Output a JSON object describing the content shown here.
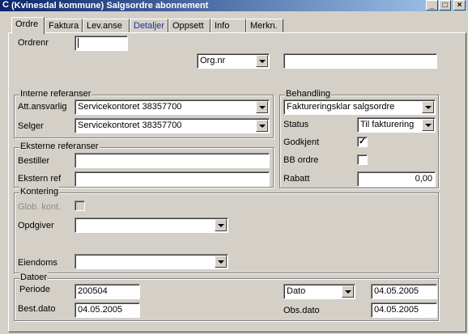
{
  "window": {
    "title": "(Kvinesdal kommune) Salgsordre abonnement",
    "title_icon_glyph": "С",
    "min_glyph": "_",
    "max_glyph": "□",
    "close_glyph": "×"
  },
  "tabs": [
    {
      "label": "Ordre"
    },
    {
      "label": "Faktura"
    },
    {
      "label": "Lev.anse"
    },
    {
      "label": "Detaljer"
    },
    {
      "label": "Oppsett"
    },
    {
      "label": "Info"
    },
    {
      "label": "Merkn."
    }
  ],
  "top": {
    "ordrenr_label": "Ordrenr",
    "ordrenr_value": "",
    "org_select_value": "Org.nr",
    "org_value": ""
  },
  "interne": {
    "title": "Interne referanser",
    "att_label": "Att.ansvarlig",
    "att_value": "Servicekontoret 38357700",
    "selger_label": "Selger",
    "selger_value": "Servicekontoret 38357700"
  },
  "eksterne": {
    "title": "Eksterne referanser",
    "bestiller_label": "Bestiller",
    "bestiller_value": "",
    "eksternref_label": "Ekstern ref",
    "eksternref_value": ""
  },
  "behandling": {
    "title": "Behandling",
    "type_value": "Faktureringsklar salgsordre",
    "status_label": "Status",
    "status_value": "Til fakturering",
    "godkjent_label": "Godkjent",
    "godkjent_mark": "✓",
    "bb_label": "BB ordre",
    "rabatt_label": "Rabatt",
    "rabatt_value": "0,00"
  },
  "kontering": {
    "title": "Kontering",
    "glob_label": "Glob. kont.",
    "opdgiver_label": "Opdgiver",
    "opdgiver_value": "",
    "eiendoms_label": "Eiendoms",
    "eiendoms_value": ""
  },
  "datoer": {
    "title": "Datoer",
    "periode_label": "Periode",
    "periode_value": "200504",
    "bestdato_label": "Best.dato",
    "bestdato_value": "04.05.2005",
    "dato_select_value": "Dato",
    "dato_value": "04.05.2005",
    "obsdato_label": "Obs.dato",
    "obsdato_value": "04.05.2005"
  }
}
